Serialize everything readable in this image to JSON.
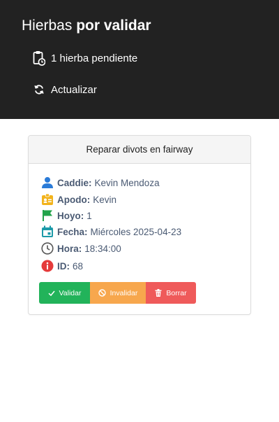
{
  "header": {
    "title_light": "Hierbas",
    "title_bold": "por validar",
    "pending_text": "1 hierba pendiente",
    "refresh_label": "Actualizar"
  },
  "card": {
    "title": "Reparar divots en fairway",
    "fields": {
      "caddie": {
        "label": "Caddie:",
        "value": "Kevin Mendoza",
        "icon": "user-icon",
        "color": "#2a7bd8"
      },
      "alias": {
        "label": "Apodo:",
        "value": "Kevin",
        "icon": "id-badge-icon",
        "color": "#f2b31c"
      },
      "hole": {
        "label": "Hoyo:",
        "value": "1",
        "icon": "flag-icon",
        "color": "#22a34a"
      },
      "date": {
        "label": "Fecha:",
        "value": "Miércoles 2025-04-23",
        "icon": "calendar-icon",
        "color": "#1c9aa8"
      },
      "time": {
        "label": "Hora:",
        "value": "18:34:00",
        "icon": "clock-icon",
        "color": "#555555"
      },
      "id": {
        "label": "ID:",
        "value": "68",
        "icon": "info-icon",
        "color": "#e53b3b"
      }
    },
    "actions": {
      "validate": "Validar",
      "invalidate": "Invalidar",
      "delete": "Borrar"
    }
  },
  "colors": {
    "header_bg": "#222222",
    "validate": "#22b35a",
    "invalidate": "#f7a74d",
    "delete": "#ef5a5a",
    "text_value": "#4a5a73"
  }
}
